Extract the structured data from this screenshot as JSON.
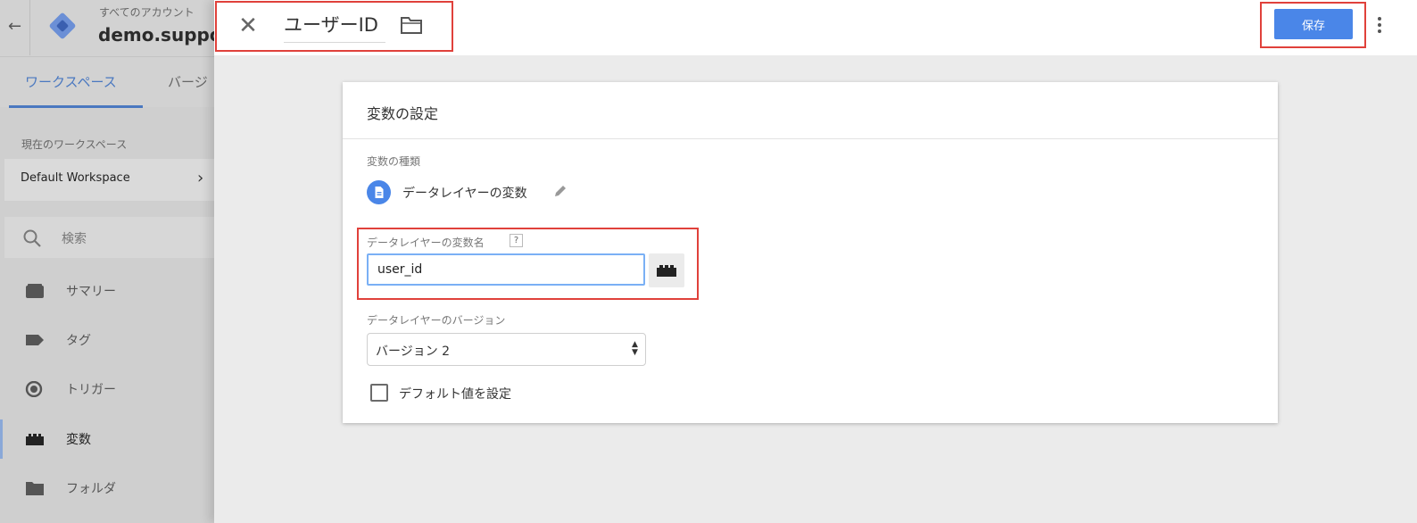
{
  "sidebar": {
    "back_icon": "arrow-left-icon",
    "account_label": "すべてのアカウント",
    "container_name": "demo.suppo",
    "tabs": [
      {
        "label": "ワークスペース",
        "active": true
      },
      {
        "label": "バージ",
        "active": false
      }
    ],
    "current_workspace_label": "現在のワークスペース",
    "workspace_name": "Default Workspace",
    "search_placeholder": "検索",
    "nav_items": [
      {
        "label": "サマリー",
        "icon": "summary-icon",
        "active": false
      },
      {
        "label": "タグ",
        "icon": "tag-icon",
        "active": false
      },
      {
        "label": "トリガー",
        "icon": "trigger-icon",
        "active": false
      },
      {
        "label": "変数",
        "icon": "variable-icon",
        "active": true
      },
      {
        "label": "フォルダ",
        "icon": "folder-icon",
        "active": false
      }
    ]
  },
  "editor": {
    "close_icon": "close-icon",
    "title": "ユーザーID",
    "folder_icon": "folder-icon",
    "save_label": "保存",
    "more_icon": "more-vert-icon"
  },
  "variable_config": {
    "card_title": "変数の設定",
    "type_label": "変数の種類",
    "type_value": "データレイヤーの変数",
    "dl_name_label": "データレイヤーの変数名",
    "help_mark": "?",
    "dl_name_value": "user_id",
    "version_label": "データレイヤーのバージョン",
    "version_value": "バージョン 2",
    "default_value_label": "デフォルト値を設定",
    "default_value_checked": false
  },
  "colors": {
    "accent": "#4a86e8",
    "highlight": "#e0413b",
    "tab_active": "#4a78c0"
  }
}
